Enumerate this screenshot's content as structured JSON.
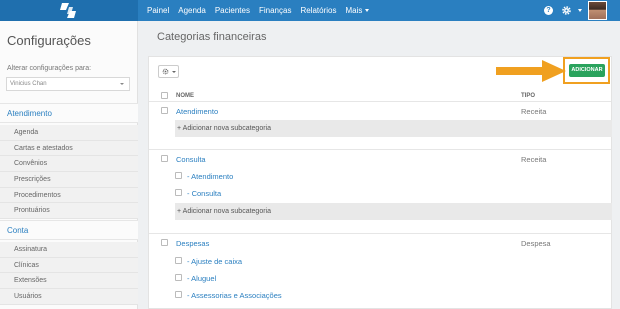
{
  "topbar": {
    "nav": [
      "Painel",
      "Agenda",
      "Pacientes",
      "Finanças",
      "Relatórios",
      "Mais"
    ],
    "help_icon": "?",
    "brand_color": "#2a7fc0"
  },
  "sidebar": {
    "title": "Configurações",
    "alter_label": "Alterar configurações para:",
    "select_value": "Vinicius Chan",
    "sections": [
      {
        "label": "Atendimento",
        "items": [
          "Agenda",
          "Cartas e atestados",
          "Convênios",
          "Prescrições",
          "Procedimentos",
          "Prontuários"
        ]
      },
      {
        "label": "Conta",
        "items": [
          "Assinatura",
          "Clínicas",
          "Extensões",
          "Usuários"
        ]
      }
    ]
  },
  "main": {
    "title": "Categorias financeiras",
    "add_button": "ADICIONAR",
    "columns": {
      "name": "NOME",
      "type": "TIPO"
    },
    "add_subcategory": "Adicionar nova subcategoria",
    "groups": [
      {
        "name": "Atendimento",
        "type": "Receita",
        "subs": []
      },
      {
        "name": "Consulta",
        "type": "Receita",
        "subs": [
          "- Atendimento",
          "- Consulta"
        ]
      },
      {
        "name": "Despesas",
        "type": "Despesa",
        "subs": [
          "- Ajuste de caixa",
          "- Aluguel",
          "- Assessorias e Associações"
        ]
      }
    ],
    "accent_color": "#2aa35d",
    "highlight_color": "#f0a020"
  }
}
